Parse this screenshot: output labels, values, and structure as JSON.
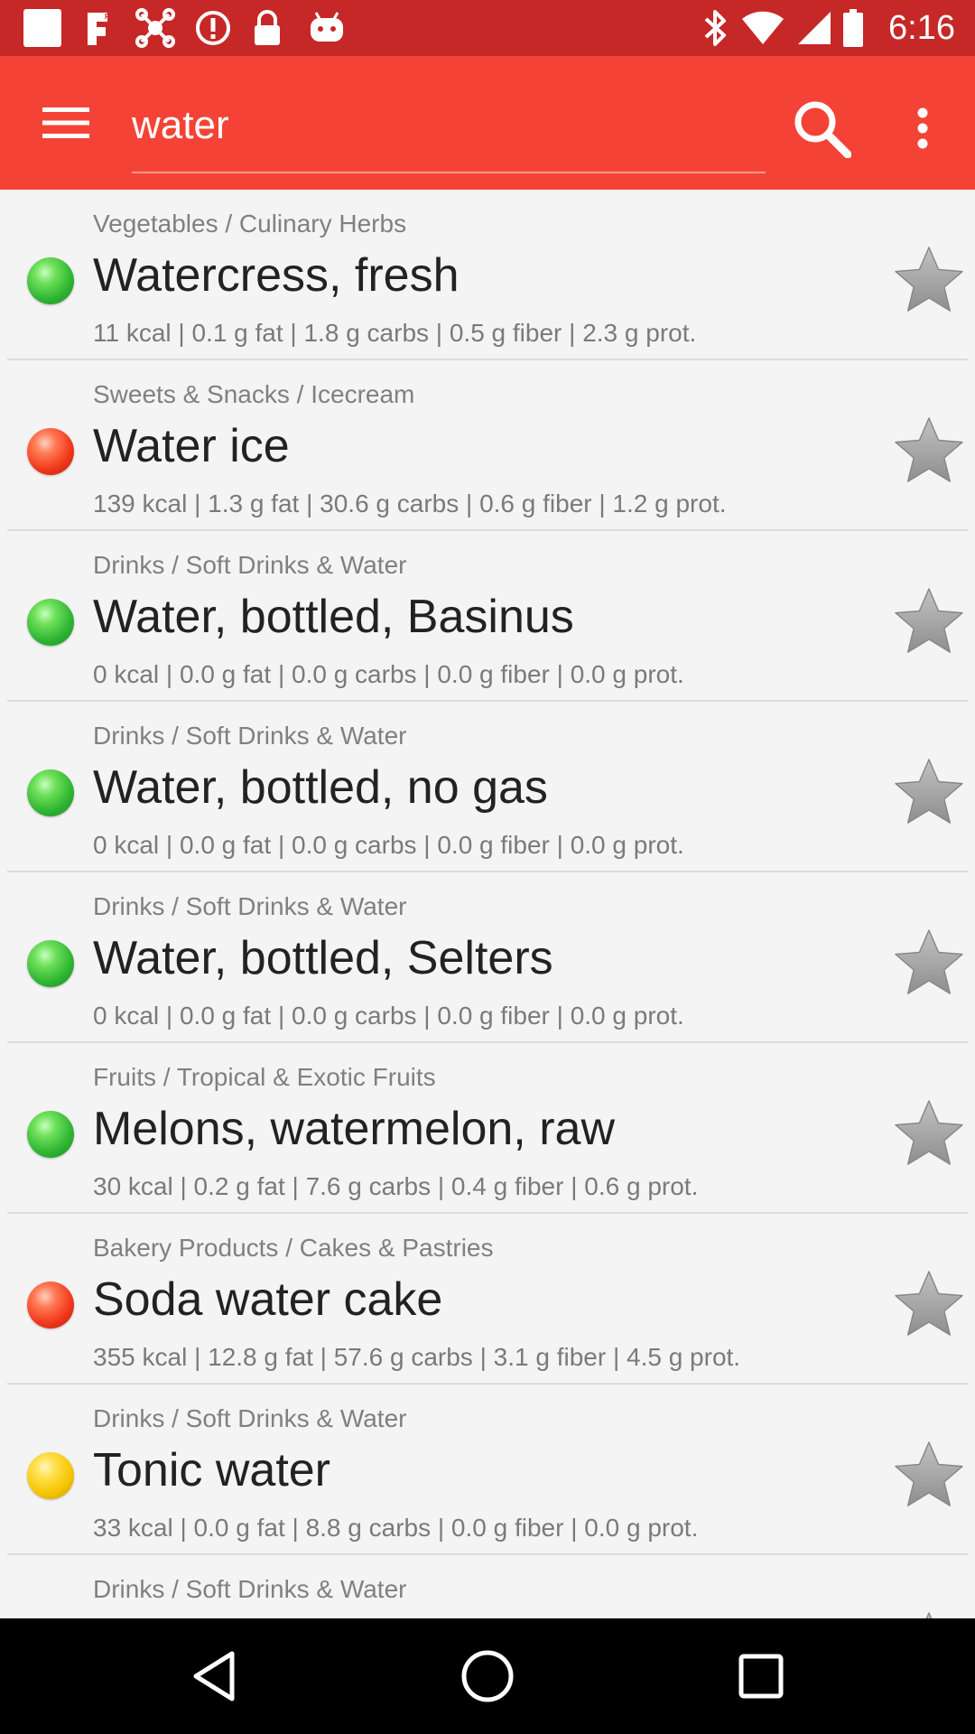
{
  "status_bar": {
    "time": "6:16",
    "left_icons": [
      "square-icon",
      "fake-gps-icon",
      "drone-icon",
      "alert-icon",
      "lock-icon",
      "android-icon"
    ],
    "right_icons": [
      "bluetooth-icon",
      "wifi-icon",
      "signal-icon",
      "battery-icon"
    ]
  },
  "app_bar": {
    "color": "#f44336",
    "search_value": "water",
    "menu_icon": "hamburger-menu-icon",
    "search_icon": "search-icon",
    "more_icon": "more-vert-icon"
  },
  "items": [
    {
      "category": "Vegetables / Culinary Herbs",
      "name": "Watercress, fresh",
      "nutrition": "11 kcal | 0.1 g fat | 1.8 g carbs | 0.5 g fiber | 2.3 g prot.",
      "rating": "green"
    },
    {
      "category": "Sweets & Snacks / Icecream",
      "name": "Water ice",
      "nutrition": "139 kcal | 1.3 g fat | 30.6 g carbs | 0.6 g fiber | 1.2 g prot.",
      "rating": "red"
    },
    {
      "category": "Drinks / Soft Drinks & Water",
      "name": "Water, bottled, Basinus",
      "nutrition": "0 kcal | 0.0 g fat | 0.0 g carbs | 0.0 g fiber | 0.0 g prot.",
      "rating": "green"
    },
    {
      "category": "Drinks / Soft Drinks & Water",
      "name": "Water, bottled, no gas",
      "nutrition": "0 kcal | 0.0 g fat | 0.0 g carbs | 0.0 g fiber | 0.0 g prot.",
      "rating": "green"
    },
    {
      "category": "Drinks / Soft Drinks & Water",
      "name": "Water, bottled, Selters",
      "nutrition": "0 kcal | 0.0 g fat | 0.0 g carbs | 0.0 g fiber | 0.0 g prot.",
      "rating": "green"
    },
    {
      "category": "Fruits / Tropical & Exotic Fruits",
      "name": "Melons, watermelon, raw",
      "nutrition": "30 kcal | 0.2 g fat | 7.6 g carbs | 0.4 g fiber | 0.6 g prot.",
      "rating": "green"
    },
    {
      "category": "Bakery Products / Cakes & Pastries",
      "name": "Soda water cake",
      "nutrition": "355 kcal | 12.8 g fat | 57.6 g carbs | 3.1 g fiber | 4.5 g prot.",
      "rating": "red"
    },
    {
      "category": "Drinks / Soft Drinks & Water",
      "name": "Tonic water",
      "nutrition": "33 kcal | 0.0 g fat | 8.8 g carbs | 0.0 g fiber | 0.0 g prot.",
      "rating": "yellow"
    },
    {
      "category": "Drinks / Soft Drinks & Water",
      "name": "",
      "nutrition": "",
      "rating": "green"
    }
  ],
  "nav_bar": {
    "back_icon": "back-triangle-icon",
    "home_icon": "home-circle-icon",
    "recents_icon": "recents-square-icon"
  }
}
